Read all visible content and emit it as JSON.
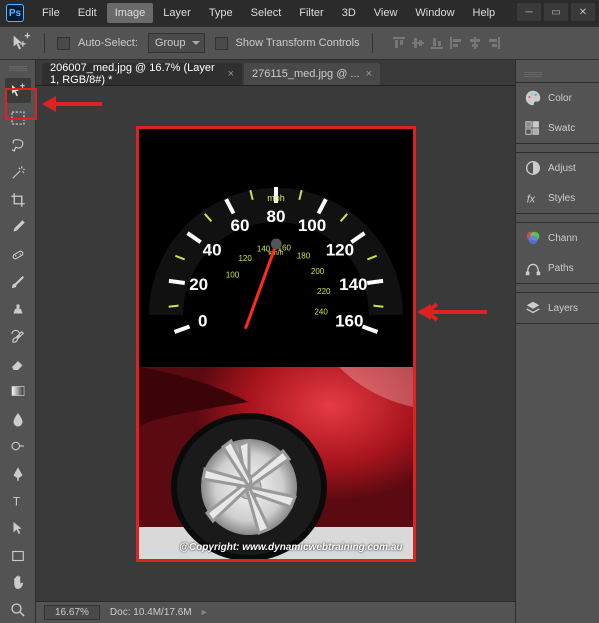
{
  "app": {
    "logo_text": "Ps"
  },
  "menus": [
    "File",
    "Edit",
    "Image",
    "Layer",
    "Type",
    "Select",
    "Filter",
    "3D",
    "View",
    "Window",
    "Help"
  ],
  "active_menu_index": 2,
  "optionbar": {
    "autoselect_label": "Auto-Select:",
    "group_label": "Group",
    "showtransform_label": "Show Transform Controls"
  },
  "tabs": [
    {
      "label": "206007_med.jpg @ 16.7% (Layer 1, RGB/8#) *",
      "active": true
    },
    {
      "label": "276115_med.jpg @ ...",
      "active": false
    }
  ],
  "status": {
    "zoom": "16.67%",
    "doc_label": "Doc:",
    "doc_value": "10.4M/17.6M"
  },
  "panels": [
    "Color",
    "Swatc",
    "Adjust",
    "Styles",
    "Chann",
    "Paths",
    "Layers"
  ],
  "canvas": {
    "copyright": "@Copyright: www.dynamicwebtraining.com.au",
    "speedometer": {
      "unit_mph": "mph",
      "unit_kmh": "km/h",
      "mph_values": [
        0,
        20,
        40,
        60,
        80,
        100,
        120,
        140,
        160
      ],
      "kmh_values": [
        100,
        120,
        140,
        160,
        180,
        200,
        220,
        240
      ]
    }
  }
}
